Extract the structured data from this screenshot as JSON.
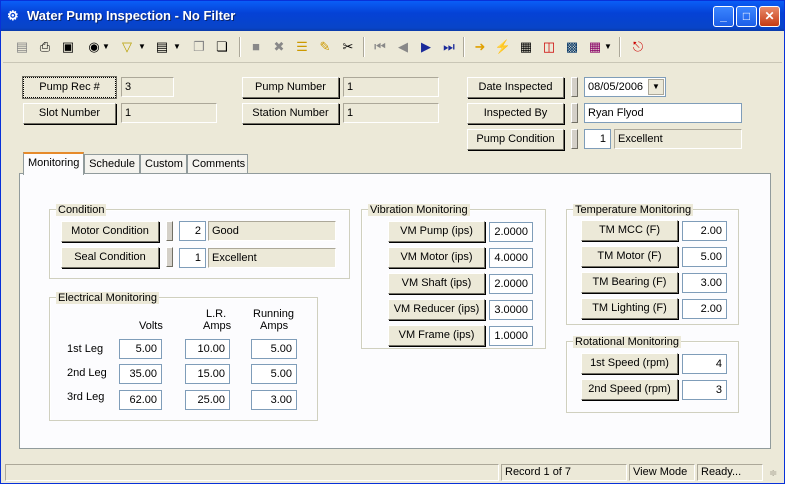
{
  "window": {
    "title": "Water Pump Inspection - No Filter"
  },
  "header": {
    "pump_rec_label": "Pump Rec #",
    "pump_rec_value": "3",
    "slot_number_label": "Slot Number",
    "slot_number_value": "1",
    "pump_number_label": "Pump Number",
    "pump_number_value": "1",
    "station_number_label": "Station Number",
    "station_number_value": "1",
    "date_inspected_label": "Date Inspected",
    "date_inspected_value": "08/05/2006",
    "inspected_by_label": "Inspected By",
    "inspected_by_value": "Ryan Flyod",
    "pump_condition_label": "Pump Condition",
    "pump_condition_code": "1",
    "pump_condition_value": "Excellent"
  },
  "tabs": [
    {
      "label": "Monitoring",
      "active": true
    },
    {
      "label": "Schedule"
    },
    {
      "label": "Custom"
    },
    {
      "label": "Comments"
    }
  ],
  "condition": {
    "title": "Condition",
    "motor_label": "Motor Condition",
    "motor_code": "2",
    "motor_value": "Good",
    "seal_label": "Seal Condition",
    "seal_code": "1",
    "seal_value": "Excellent"
  },
  "electrical": {
    "title": "Electrical Monitoring",
    "col_volts": "Volts",
    "col_lr_1": "L.R.",
    "col_lr_2": "Amps",
    "col_run_1": "Running",
    "col_run_2": "Amps",
    "rows": [
      {
        "label": "1st Leg",
        "volts": "5.00",
        "lr": "10.00",
        "run": "5.00"
      },
      {
        "label": "2nd Leg",
        "volts": "35.00",
        "lr": "15.00",
        "run": "5.00"
      },
      {
        "label": "3rd Leg",
        "volts": "62.00",
        "lr": "25.00",
        "run": "3.00"
      }
    ]
  },
  "vibration": {
    "title": "Vibration Monitoring",
    "rows": [
      {
        "label": "VM Pump (ips)",
        "value": "2.0000"
      },
      {
        "label": "VM Motor (ips)",
        "value": "4.0000"
      },
      {
        "label": "VM Shaft (ips)",
        "value": "2.0000"
      },
      {
        "label": "VM Reducer (ips)",
        "value": "3.0000"
      },
      {
        "label": "VM Frame (ips)",
        "value": "1.0000"
      }
    ]
  },
  "temperature": {
    "title": "Temperature Monitoring",
    "rows": [
      {
        "label": "TM MCC (F)",
        "value": "2.00"
      },
      {
        "label": "TM Motor (F)",
        "value": "5.00"
      },
      {
        "label": "TM Bearing (F)",
        "value": "3.00"
      },
      {
        "label": "TM Lighting (F)",
        "value": "2.00"
      }
    ]
  },
  "rotational": {
    "title": "Rotational Monitoring",
    "rows": [
      {
        "label": "1st Speed (rpm)",
        "value": "4"
      },
      {
        "label": "2nd Speed (rpm)",
        "value": "3"
      }
    ]
  },
  "status": {
    "record": "Record 1 of 7",
    "mode": "View Mode",
    "state": "Ready..."
  }
}
